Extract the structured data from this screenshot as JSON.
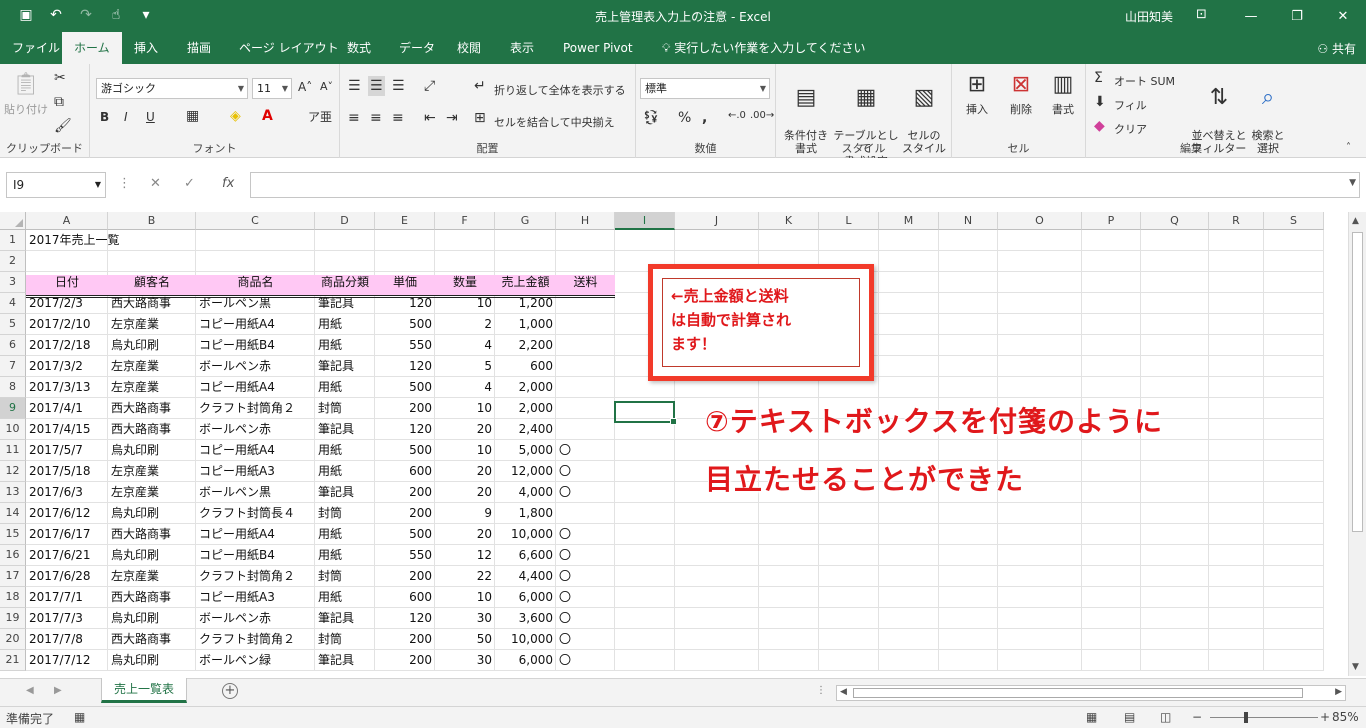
{
  "titlebar": {
    "title": "売上管理表入力上の注意  -  Excel",
    "user": "山田知美"
  },
  "tabs": [
    "ファイル",
    "ホーム",
    "挿入",
    "描画",
    "ページ レイアウト",
    "数式",
    "データ",
    "校閲",
    "表示",
    "Power Pivot"
  ],
  "tell_me": "実行したい作業を入力してください",
  "share": "共有",
  "ribbon": {
    "clipboard": {
      "paste": "貼り付け",
      "label": "クリップボード"
    },
    "font": {
      "name": "游ゴシック",
      "size": "11",
      "bold": "B",
      "italic": "I",
      "underline": "U",
      "label": "フォント"
    },
    "alignment": {
      "wrap": "折り返して全体を表示する",
      "merge": "セルを結合して中央揃え",
      "label": "配置"
    },
    "number": {
      "format": "標準",
      "percent": "%",
      "label": "数値"
    },
    "styles": {
      "conditional": "条件付き\n書式",
      "table": "テーブルとして\n書式設定",
      "cell": "セルの\nスタイル",
      "label": "スタイル"
    },
    "cells": {
      "insert": "挿入",
      "delete": "削除",
      "format": "書式",
      "label": "セル"
    },
    "editing": {
      "autosum": "オート SUM",
      "fill": "フィル",
      "clear": "クリア",
      "sort": "並べ替えと\nフィルター",
      "find": "検索と\n選択",
      "label": "編集"
    }
  },
  "namebox": "I9",
  "columns": [
    "A",
    "B",
    "C",
    "D",
    "E",
    "F",
    "G",
    "H",
    "I",
    "J",
    "K",
    "L",
    "M",
    "N",
    "O",
    "P",
    "Q",
    "R",
    "S"
  ],
  "selected_column": "I",
  "selected_row": 9,
  "sheet": {
    "title": "2017年売上一覧",
    "headers": [
      "日付",
      "顧客名",
      "商品名",
      "商品分類",
      "単価",
      "数量",
      "売上金額",
      "送料"
    ],
    "rows": [
      [
        "2017/2/3",
        "西大路商事",
        "ボールペン黒",
        "筆記具",
        "120",
        "10",
        "1,200",
        ""
      ],
      [
        "2017/2/10",
        "左京産業",
        "コピー用紙A4",
        "用紙",
        "500",
        "2",
        "1,000",
        ""
      ],
      [
        "2017/2/18",
        "烏丸印刷",
        "コピー用紙B4",
        "用紙",
        "550",
        "4",
        "2,200",
        ""
      ],
      [
        "2017/3/2",
        "左京産業",
        "ボールペン赤",
        "筆記具",
        "120",
        "5",
        "600",
        ""
      ],
      [
        "2017/3/13",
        "左京産業",
        "コピー用紙A4",
        "用紙",
        "500",
        "4",
        "2,000",
        ""
      ],
      [
        "2017/4/1",
        "西大路商事",
        "クラフト封筒角２",
        "封筒",
        "200",
        "10",
        "2,000",
        ""
      ],
      [
        "2017/4/15",
        "西大路商事",
        "ボールペン赤",
        "筆記具",
        "120",
        "20",
        "2,400",
        ""
      ],
      [
        "2017/5/7",
        "烏丸印刷",
        "コピー用紙A4",
        "用紙",
        "500",
        "10",
        "5,000",
        "〇"
      ],
      [
        "2017/5/18",
        "左京産業",
        "コピー用紙A3",
        "用紙",
        "600",
        "20",
        "12,000",
        "〇"
      ],
      [
        "2017/6/3",
        "左京産業",
        "ボールペン黒",
        "筆記具",
        "200",
        "20",
        "4,000",
        "〇"
      ],
      [
        "2017/6/12",
        "烏丸印刷",
        "クラフト封筒長４",
        "封筒",
        "200",
        "9",
        "1,800",
        ""
      ],
      [
        "2017/6/17",
        "西大路商事",
        "コピー用紙A4",
        "用紙",
        "500",
        "20",
        "10,000",
        "〇"
      ],
      [
        "2017/6/21",
        "烏丸印刷",
        "コピー用紙B4",
        "用紙",
        "550",
        "12",
        "6,600",
        "〇"
      ],
      [
        "2017/6/28",
        "左京産業",
        "クラフト封筒角２",
        "封筒",
        "200",
        "22",
        "4,400",
        "〇"
      ],
      [
        "2017/7/1",
        "西大路商事",
        "コピー用紙A3",
        "用紙",
        "600",
        "10",
        "6,000",
        "〇"
      ],
      [
        "2017/7/3",
        "烏丸印刷",
        "ボールペン赤",
        "筆記具",
        "120",
        "30",
        "3,600",
        "〇"
      ],
      [
        "2017/7/8",
        "西大路商事",
        "クラフト封筒角２",
        "封筒",
        "200",
        "50",
        "10,000",
        "〇"
      ],
      [
        "2017/7/12",
        "烏丸印刷",
        "ボールペン緑",
        "筆記具",
        "200",
        "30",
        "6,000",
        "〇"
      ]
    ]
  },
  "note_text": "←売上金額と送料\nは自動で計算され\nます！",
  "callout_text": "⑦テキストボックスを付箋のように\n目立たせることができた",
  "sheet_tab": "売上一覧表",
  "status": {
    "ready": "準備完了",
    "zoom": "85%"
  },
  "colors": {
    "excel_green": "#217346",
    "header_pink": "#ffc8f4",
    "note_red": "#f23a2a"
  }
}
